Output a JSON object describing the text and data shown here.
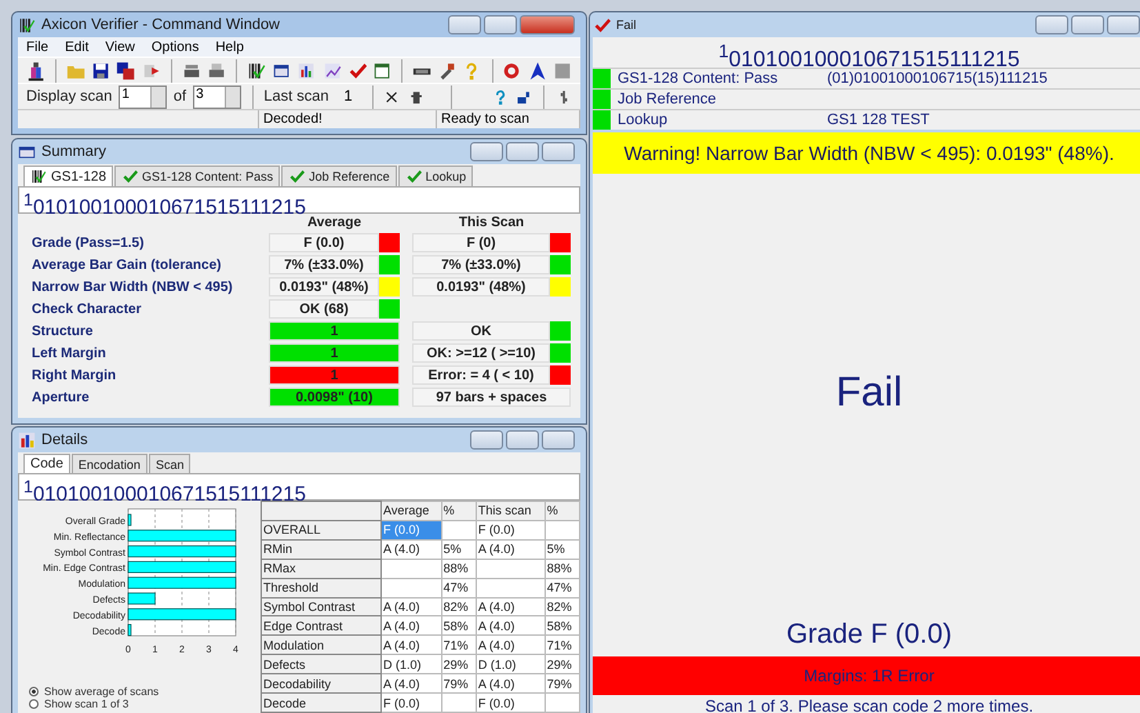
{
  "command_window": {
    "title": "Axicon Verifier - Command Window",
    "active": true,
    "menu": [
      "File",
      "Edit",
      "View",
      "Options",
      "Help"
    ],
    "display_scan": {
      "label": "Display scan",
      "value": "1",
      "of_label": "of",
      "of_value": "3"
    },
    "last_scan": {
      "label": "Last scan",
      "value": "1"
    },
    "status_bar": [
      "Decoded!",
      "Ready to scan"
    ]
  },
  "summary": {
    "title": "Summary",
    "active": false,
    "tabs": [
      {
        "label": "GS1-128",
        "kind": "barcode",
        "selected": true
      },
      {
        "label": "GS1-128 Content: Pass",
        "kind": "check",
        "selected": false
      },
      {
        "label": "Job Reference",
        "kind": "check",
        "selected": false
      },
      {
        "label": "Lookup",
        "kind": "check",
        "selected": false
      }
    ],
    "code": "$^{1}$010100100010671515111215",
    "headers": [
      "Average",
      "This Scan"
    ],
    "rows": [
      {
        "label": "Grade (Pass=1.5)",
        "average": {
          "kind": "indicator",
          "text": "F (0.0)",
          "color": "#ff0000"
        },
        "this_scan": {
          "kind": "indicator",
          "text": "F (0)",
          "color": "#ff0000"
        }
      },
      {
        "label": "Average Bar Gain (tolerance)",
        "average": {
          "kind": "indicator",
          "text": "7% (±33.0%)",
          "color": "#00e000"
        },
        "this_scan": {
          "kind": "indicator",
          "text": "7% (±33.0%)",
          "color": "#00e000"
        }
      },
      {
        "label": "Narrow Bar Width (NBW < 495)",
        "average": {
          "kind": "indicator",
          "text": "0.0193\" (48%)",
          "color": "#ffff00"
        },
        "this_scan": {
          "kind": "indicator",
          "text": "0.0193\" (48%)",
          "color": "#ffff00"
        }
      },
      {
        "label": "Check Character",
        "average": {
          "kind": "indicator",
          "text": "OK (68)",
          "color": "#00e000"
        }
      },
      {
        "label": "Structure",
        "average": {
          "kind": "filled",
          "text": "1",
          "color": "#00e000"
        },
        "this_scan": {
          "kind": "indicator",
          "text": "OK",
          "color": "#00e000"
        }
      },
      {
        "label": "Left Margin",
        "average": {
          "kind": "filled",
          "text": "1",
          "color": "#00e000"
        },
        "this_scan": {
          "kind": "indicator",
          "text": "OK:   >=12 ( >=10)",
          "color": "#00e000"
        }
      },
      {
        "label": "Right Margin",
        "average": {
          "kind": "filled",
          "text": "1",
          "color": "#ff0000"
        },
        "this_scan": {
          "kind": "indicator",
          "text": "Error: = 4 ( < 10)",
          "color": "#ff0000"
        }
      },
      {
        "label": "Aperture",
        "average": {
          "kind": "filled",
          "text": "0.0098\" (10)",
          "color": "#00e000"
        },
        "this_scan": {
          "kind": "plain",
          "text": "97 bars + spaces"
        }
      }
    ]
  },
  "details": {
    "title": "Details",
    "active": false,
    "tabs": [
      {
        "label": "Code",
        "selected": true
      },
      {
        "label": "Encodation",
        "selected": false
      },
      {
        "label": "Scan",
        "selected": false
      }
    ],
    "code": "$^{1}$010100100010671515111215",
    "chart_data": {
      "type": "bar",
      "orientation": "horizontal",
      "categories": [
        "Overall Grade",
        "Min. Reflectance",
        "Symbol Contrast",
        "Min. Edge Contrast",
        "Modulation",
        "Defects",
        "Decodability",
        "Decode"
      ],
      "values": [
        0,
        4,
        4,
        4,
        4,
        1,
        4,
        0
      ],
      "xlim": [
        0,
        4
      ],
      "xticks": [
        0,
        1,
        2,
        3,
        4
      ],
      "grid": true
    },
    "radios": [
      {
        "label": "Show average of scans",
        "selected": true
      },
      {
        "label": "Show scan 1 of 3",
        "selected": false
      }
    ],
    "table": {
      "columns": [
        "Average",
        "%",
        "This scan",
        "%"
      ],
      "rows": [
        {
          "label": "OVERALL",
          "average": "F (0.0)",
          "this_scan": "F (0.0)",
          "selected": true
        },
        {
          "label": "RMin",
          "average": "A (4.0)",
          "average_pct": "5%",
          "this_scan": "A (4.0)",
          "this_pct": "5%",
          "selected": false
        },
        {
          "label": "RMax",
          "average_pct": "88%",
          "this_pct": "88%",
          "selected": false
        },
        {
          "label": "Threshold",
          "average_pct": "47%",
          "this_pct": "47%",
          "selected": false
        },
        {
          "label": "Symbol Contrast",
          "average": "A (4.0)",
          "average_pct": "82%",
          "this_scan": "A (4.0)",
          "this_pct": "82%",
          "selected": false
        },
        {
          "label": "Edge Contrast",
          "average": "A (4.0)",
          "average_pct": "58%",
          "this_scan": "A (4.0)",
          "this_pct": "58%",
          "selected": false
        },
        {
          "label": "Modulation",
          "average": "A (4.0)",
          "average_pct": "71%",
          "this_scan": "A (4.0)",
          "this_pct": "71%",
          "selected": false
        },
        {
          "label": "Defects",
          "average": "D (1.0)",
          "average_pct": "29%",
          "this_scan": "D (1.0)",
          "this_pct": "29%",
          "selected": false
        },
        {
          "label": "Decodability",
          "average": "A (4.0)",
          "average_pct": "79%",
          "this_scan": "A (4.0)",
          "this_pct": "79%",
          "selected": false
        },
        {
          "label": "Decode",
          "average": "F (0.0)",
          "this_scan": "F (0.0)",
          "selected": false
        }
      ]
    }
  },
  "fail_window": {
    "title": "Fail",
    "active": false,
    "code": "$^{1}$010100100010671515111215",
    "checks": [
      {
        "label": "GS1-128 Content: Pass",
        "value": "(01)01001000106715(15)111215",
        "color": "#00dd00"
      },
      {
        "label": "Job Reference",
        "color": "#00dd00"
      },
      {
        "label": "Lookup",
        "value": "GS1 128 TEST",
        "color": "#00dd00"
      }
    ],
    "warning": "Warning! Narrow Bar Width (NBW < 495): 0.0193\" (48%).",
    "result": "Fail",
    "grade": "Grade F (0.0)",
    "error": "Margins:  1R Error",
    "message": "Scan 1 of 3. Please scan code 2 more times."
  }
}
